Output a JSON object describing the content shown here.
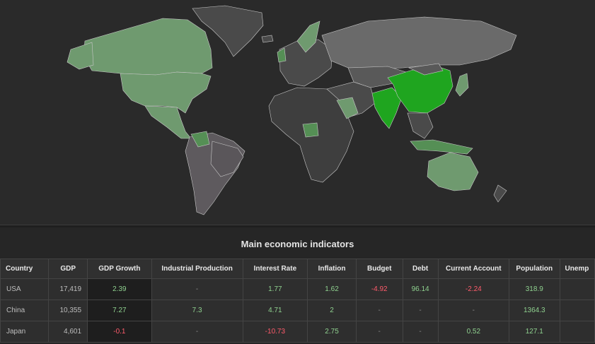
{
  "map": {
    "colors": {
      "background": "#2a2a2a",
      "no_data": "#4a4a4a",
      "low": "#6f9a6f",
      "mid": "#558f55",
      "high": "#1fa51f",
      "border": "#c9c9c9"
    },
    "highlighted_countries": [
      "USA",
      "China",
      "India",
      "Japan",
      "Australia",
      "Canada",
      "Mexico"
    ]
  },
  "table": {
    "title": "Main economic indicators",
    "headers": [
      "Country",
      "GDP",
      "GDP Growth",
      "Industrial Production",
      "Interest Rate",
      "Inflation",
      "Budget",
      "Debt",
      "Current Account",
      "Population",
      "Unemp"
    ],
    "rows": [
      [
        "USA",
        "17,419",
        "2.39",
        "-",
        "1.77",
        "1.62",
        "-4.92",
        "96.14",
        "-2.24",
        "318.9",
        ""
      ],
      [
        "China",
        "10,355",
        "7.27",
        "7.3",
        "4.71",
        "2",
        "-",
        "-",
        "-",
        "1364.3",
        ""
      ],
      [
        "Japan",
        "4,601",
        "-0.1",
        "-",
        "-10.73",
        "2.75",
        "-",
        "-",
        "0.52",
        "127.1",
        ""
      ]
    ]
  }
}
